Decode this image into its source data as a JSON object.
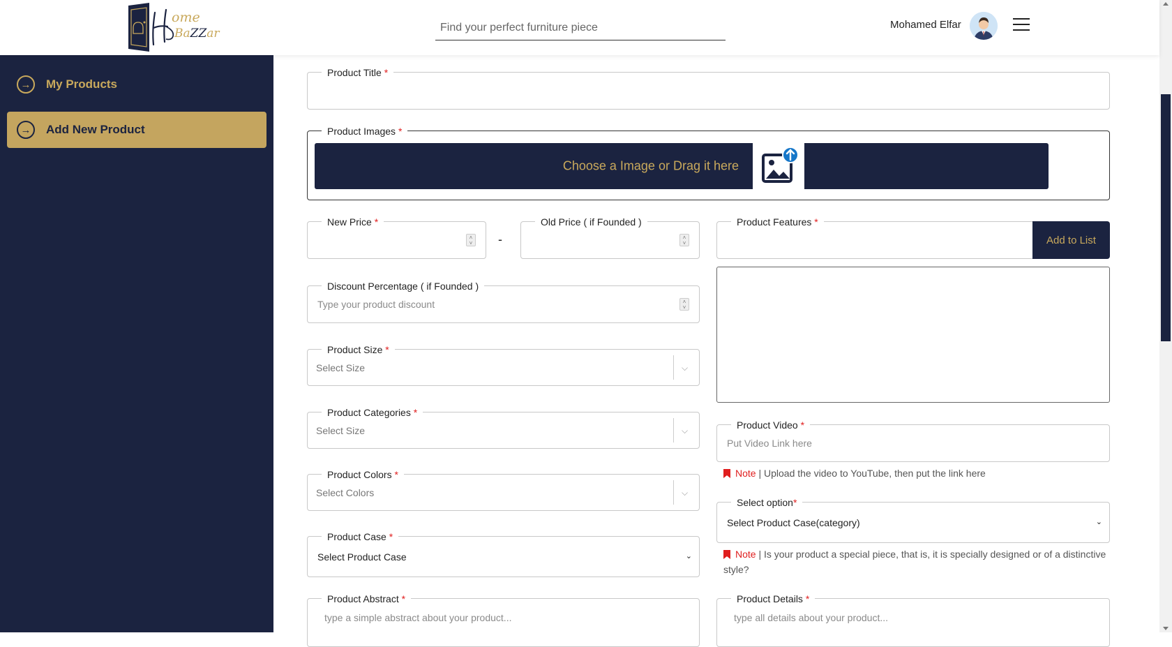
{
  "header": {
    "logo_text": "Home BaZZar",
    "search_placeholder": "Find your perfect furniture piece",
    "user_name": "Mohamed Elfar",
    "avatar_icon": "user-avatar",
    "menu_icon": "hamburger-menu-icon"
  },
  "sidebar": {
    "items": [
      {
        "label": "My Products",
        "icon": "arrow-right-circle-icon"
      },
      {
        "label": "Add New Product",
        "icon": "arrow-right-circle-icon",
        "active": true
      }
    ]
  },
  "form": {
    "product_title": {
      "label": "Product Title",
      "value": ""
    },
    "product_images": {
      "label": "Product Images",
      "drop_text": "Choose a Image or Drag it here"
    },
    "new_price": {
      "label": "New Price"
    },
    "old_price": {
      "label": "Old Price ( if Founded )"
    },
    "price_separator": "-",
    "discount": {
      "label": "Discount Percentage ( if Founded )",
      "placeholder": "Type your product discount"
    },
    "size": {
      "label": "Product Size",
      "placeholder": "Select Size"
    },
    "categories": {
      "label": "Product Categories",
      "placeholder": "Select Size"
    },
    "colors": {
      "label": "Product Colors",
      "placeholder": "Select Colors"
    },
    "case": {
      "label": "Product Case",
      "value": "Select Product Case"
    },
    "abstract": {
      "label": "Product Abstract",
      "placeholder": "type a simple abstract about your product..."
    },
    "features": {
      "label": "Product Features",
      "button": "Add to List"
    },
    "video": {
      "label": "Product Video",
      "placeholder": "Put Video Link here"
    },
    "video_note": {
      "label": "Note",
      "text": " | Upload the video to YouTube, then put the link here"
    },
    "select_option": {
      "label": "Select option",
      "value": "Select Product Case(category)"
    },
    "option_note": {
      "label": "Note",
      "text": " | Is your product a special piece, that is, it is specially designed or of a distinctive style?"
    },
    "details": {
      "label": "Product Details",
      "placeholder": "type all details about your product..."
    },
    "required_mark": "*"
  },
  "colors": {
    "navy": "#1b2340",
    "gold": "#c4a55f",
    "required_red": "#e01e1e"
  }
}
